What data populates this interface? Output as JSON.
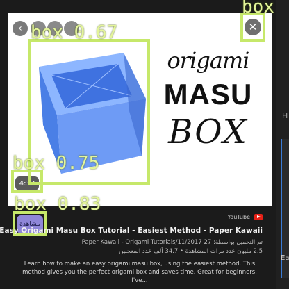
{
  "thumbnail": {
    "line1": "origami",
    "line2": "MASU",
    "line3": "BOX",
    "duration": "4:33",
    "back_icon": "chevron-left-icon",
    "close_icon": "close-icon"
  },
  "detections": [
    {
      "label": "box",
      "score": "0.67",
      "text": "box 0.67"
    },
    {
      "label": "box",
      "score": "0.75",
      "text": "box 0.75"
    },
    {
      "label": "box",
      "score": "0.83",
      "text": "box 0.83"
    },
    {
      "label": "box",
      "text": "box"
    }
  ],
  "video": {
    "source": "YouTube",
    "watch_label": "مشاهدة",
    "title": "Easy Origami Masu Box Tutorial - Easiest Method - Paper Kawaii",
    "upload_line": "تم التحميل بواسطة: 27 Paper Kawaii - Origami Tutorials/11/2017",
    "stats_line": "2.5 مليون عدد مرات المشاهدة • 34.7 ألف عدد المعجبين",
    "description": "Learn how to make an easy origami masu box, using the easiest method. This method gives you the perfect origami box and saves time. Great for beginners. I've..."
  },
  "side": {
    "peek_h": "H",
    "peek_ea": "Ea"
  },
  "colors": {
    "detection": "#c6e86a",
    "watch_button": "#8f86d8",
    "box_blue": "#5b8ef0"
  }
}
